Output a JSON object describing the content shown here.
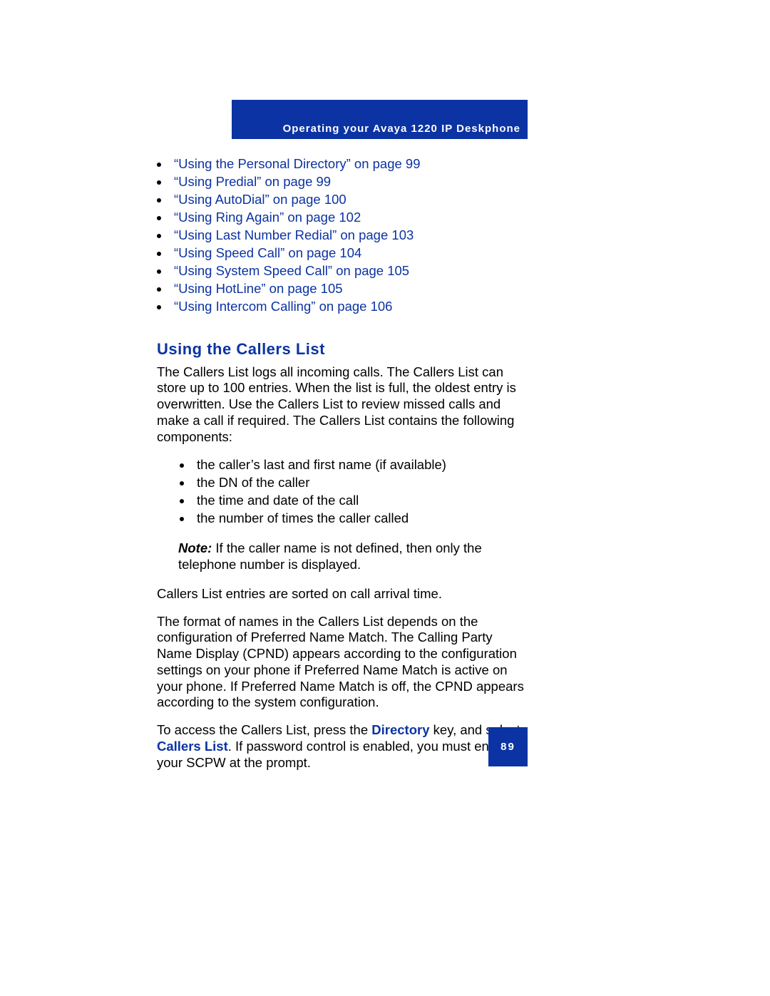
{
  "header": {
    "title": "Operating your Avaya 1220 IP Deskphone"
  },
  "links": [
    "“Using the Personal Directory” on page 99",
    "“Using Predial” on page 99",
    "“Using AutoDial” on page 100",
    "“Using Ring Again” on page 102",
    "“Using Last Number Redial” on page 103",
    "“Using Speed Call” on page 104",
    "“Using System Speed Call” on page 105",
    "“Using HotLine” on page 105",
    "“Using Intercom Calling” on page 106"
  ],
  "section": {
    "heading": "Using the Callers List",
    "intro": "The Callers List logs all incoming calls. The Callers List can store up to 100 entries. When the list is full, the oldest entry is overwritten. Use the Callers List to review missed calls and make a call if required. The Callers List contains the following components:",
    "components": [
      "the caller’s last and first name (if available)",
      "the DN of the caller",
      "the time and date of the call",
      "the number of times the caller called"
    ],
    "note_label": "Note:",
    "note_text": " If the caller name is not defined, then only the telephone number is displayed.",
    "p2": "Callers List entries are sorted on call arrival time.",
    "p3": "The format of names in the Callers List depends on the configuration of Preferred Name Match. The Calling Party Name Display (CPND) appears according to the configuration settings on your phone if Preferred Name Match is active on your phone. If Preferred Name Match is off, the CPND appears according to the system configuration.",
    "p4_pre": "To access the Callers List, press the ",
    "p4_kw1": "Directory",
    "p4_mid": " key, and select ",
    "p4_kw2": "Callers List",
    "p4_post": ". If password control is enabled, you must enter your SCPW at the prompt."
  },
  "page_number": "89"
}
